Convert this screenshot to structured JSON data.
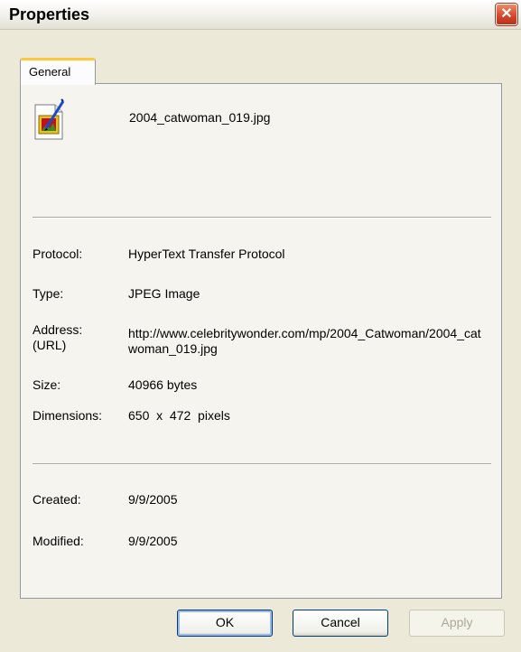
{
  "window": {
    "title": "Properties",
    "close_symbol": "✕"
  },
  "tabs": [
    {
      "label": "General",
      "selected": true
    }
  ],
  "file": {
    "icon": "jpeg-image-file-icon",
    "name": "2004_catwoman_019.jpg"
  },
  "properties": {
    "protocol": {
      "label": "Protocol:",
      "value": "HyperText Transfer Protocol"
    },
    "type": {
      "label": "Type:",
      "value": "JPEG Image"
    },
    "address": {
      "label": "Address: (URL)",
      "value": "http://www.celebritywonder.com/mp/2004_Catwoman/2004_catwoman_019.jpg"
    },
    "size": {
      "label": "Size:",
      "value": "40966 bytes"
    },
    "dimensions": {
      "label": "Dimensions:",
      "value": "650  x  472  pixels"
    },
    "created": {
      "label": "Created:",
      "value": "9/9/2005"
    },
    "modified": {
      "label": "Modified:",
      "value": "9/9/2005"
    }
  },
  "buttons": {
    "ok": "OK",
    "cancel": "Cancel",
    "apply": "Apply"
  },
  "colors": {
    "tab_accent": "#ffc83c",
    "close_button": "#d2452a",
    "dialog_background": "#ece9d8"
  }
}
